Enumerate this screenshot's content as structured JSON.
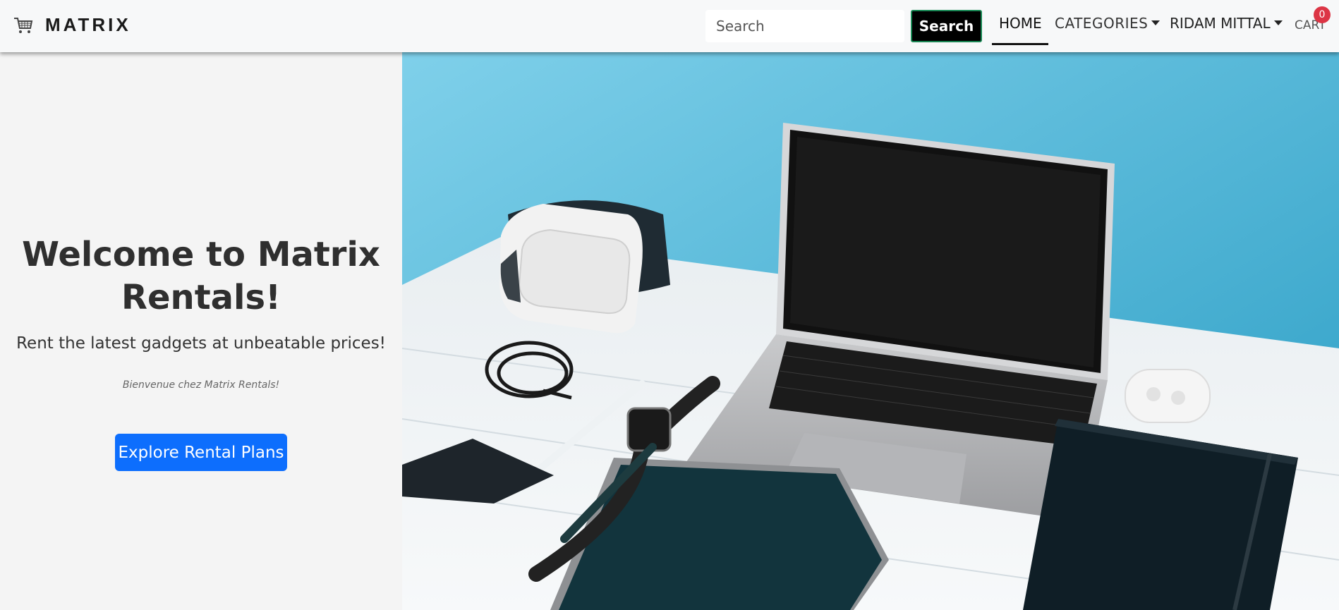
{
  "navbar": {
    "brand": "MATRIX",
    "brand_icon": "shopping-cart-icon",
    "search_placeholder": "Search",
    "search_button": "Search",
    "home": "HOME",
    "categories": "CATEGORIES",
    "user": "RIDAM MITTAL",
    "cart": "CART",
    "cart_count": "0"
  },
  "hero": {
    "title": "Welcome to Matrix Rentals!",
    "subtitle": "Rent the latest gadgets at unbeatable prices!",
    "tagline_fr": "Bienvenue chez Matrix Rentals!",
    "cta": "Explore Rental Plans"
  },
  "colors": {
    "primary": "#0d6efd",
    "badge": "#dc3545",
    "search_border": "#198754",
    "wall": "#3fb3d6"
  }
}
